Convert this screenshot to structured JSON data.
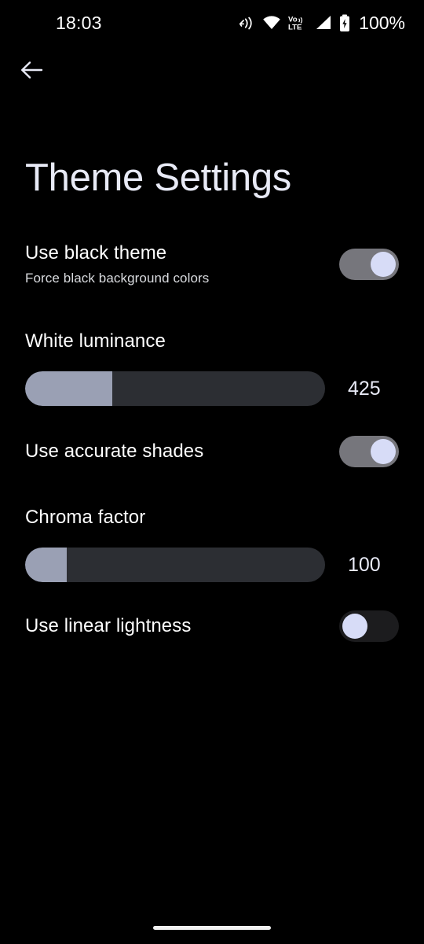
{
  "statusbar": {
    "time": "18:03",
    "battery_percent": "100%",
    "icons": [
      "nfc-icon",
      "wifi-icon",
      "volte-icon",
      "signal-icon",
      "battery-icon"
    ]
  },
  "navigation": {
    "back_label": "Back"
  },
  "header": {
    "title": "Theme Settings"
  },
  "settings": {
    "black_theme": {
      "title": "Use black theme",
      "subtitle": "Force black background colors",
      "state": "on"
    },
    "white_luminance": {
      "label": "White luminance",
      "value": "425",
      "fill_percent": 29
    },
    "accurate_shades": {
      "title": "Use accurate shades",
      "state": "on"
    },
    "chroma_factor": {
      "label": "Chroma factor",
      "value": "100",
      "fill_percent": 14
    },
    "linear_lightness": {
      "title": "Use linear lightness",
      "state": "off"
    }
  },
  "colors": {
    "background": "#000000",
    "title_text": "#e8eaf6",
    "primary_text": "#ffffff",
    "secondary_text": "#dadce0",
    "toggle_on_track": "#76767c",
    "toggle_off_track": "#1c1c1e",
    "toggle_thumb": "#d7dcf7",
    "slider_track": "#2c2e33",
    "slider_fill": "#9aa0b4"
  }
}
